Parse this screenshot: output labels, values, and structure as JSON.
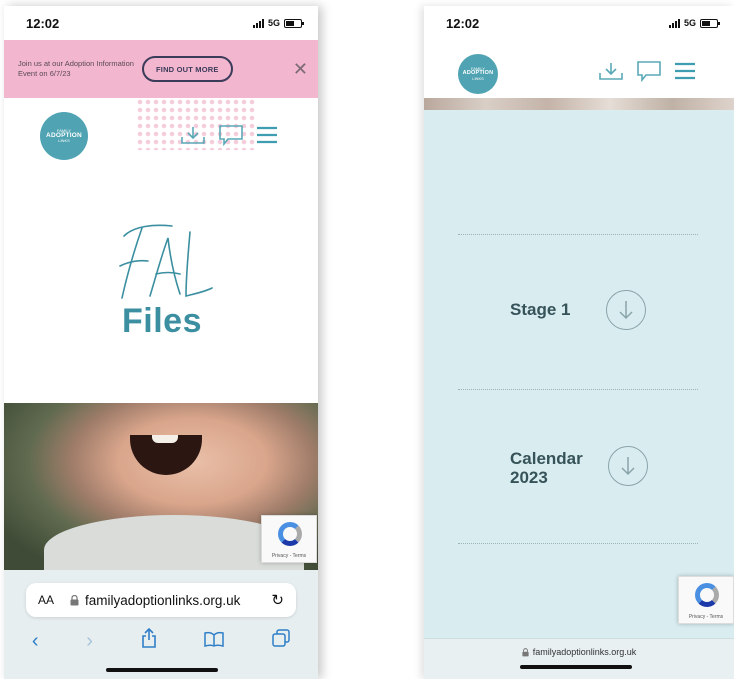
{
  "left_phone": {
    "status": {
      "time": "12:02",
      "network": "5G"
    },
    "banner": {
      "text": "Join us at our Adoption Information Event on 6/7/23",
      "button_label": "FIND OUT MORE",
      "close_icon": "close-icon"
    },
    "logo": {
      "line1": "FAMILY",
      "line2": "ADOPTION",
      "line3": "LINKS"
    },
    "nav": {
      "icons": [
        "download-icon",
        "chat-icon",
        "hamburger-menu-icon"
      ]
    },
    "hero": {
      "script_title": "FAL",
      "title": "Files"
    },
    "recaptcha": {
      "text": "Privacy - Terms"
    },
    "browser": {
      "aa_label": "AA",
      "url": "familyadoptionlinks.org.uk",
      "toolbar_icons": [
        "back-icon",
        "forward-icon",
        "share-icon",
        "bookmarks-icon",
        "tabs-icon"
      ]
    }
  },
  "right_phone": {
    "status": {
      "time": "12:02",
      "network": "5G"
    },
    "logo": {
      "line1": "FAMILY",
      "line2": "ADOPTION",
      "line3": "LINKS"
    },
    "nav": {
      "icons": [
        "download-icon",
        "chat-icon",
        "hamburger-menu-icon"
      ]
    },
    "documents": [
      {
        "label": "Stage 1",
        "icon": "download-arrow-icon"
      },
      {
        "label": "Calendar 2023",
        "icon": "download-arrow-icon"
      }
    ],
    "recaptcha": {
      "text": "Privacy - Terms"
    },
    "browser": {
      "url": "familyadoptionlinks.org.uk"
    }
  },
  "colors": {
    "banner_pink": "#f2b6cf",
    "brand_teal": "#4fa3b2",
    "title_teal": "#3b8fa0",
    "panel_blue": "#d9edf1"
  }
}
